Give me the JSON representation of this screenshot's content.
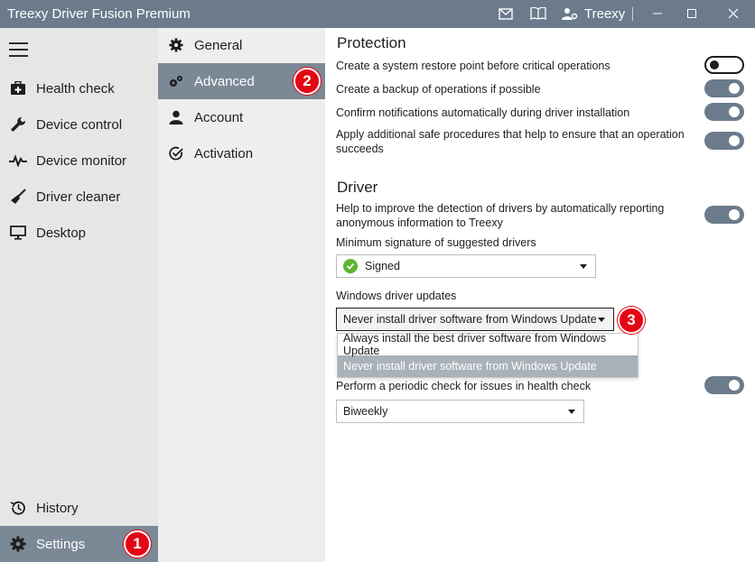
{
  "window": {
    "title": "Treexy Driver Fusion Premium",
    "user_label": "Treexy"
  },
  "leftnav": {
    "items": [
      {
        "label": "Health check"
      },
      {
        "label": "Device control"
      },
      {
        "label": "Device monitor"
      },
      {
        "label": "Driver cleaner"
      },
      {
        "label": "Desktop"
      }
    ],
    "bottom": [
      {
        "label": "History"
      },
      {
        "label": "Settings"
      }
    ]
  },
  "subnav": {
    "items": [
      {
        "label": "General"
      },
      {
        "label": "Advanced"
      },
      {
        "label": "Account"
      },
      {
        "label": "Activation"
      }
    ]
  },
  "badges": [
    "1",
    "2",
    "3"
  ],
  "protection": {
    "title": "Protection",
    "options": [
      {
        "text": "Create a system restore point before critical operations",
        "enabled": false
      },
      {
        "text": "Create a backup of operations if possible",
        "enabled": true
      },
      {
        "text": "Confirm notifications automatically during driver installation",
        "enabled": true
      },
      {
        "text": "Apply additional safe procedures that help to ensure that an operation succeeds",
        "enabled": true
      }
    ]
  },
  "driver": {
    "title": "Driver",
    "report_option": {
      "text": "Help to improve the detection of drivers by automatically reporting anonymous information to Treexy",
      "enabled": true
    },
    "signature_label": "Minimum signature of suggested drivers",
    "signature_value": "Signed",
    "updates_label": "Windows driver updates",
    "updates_value": "Never install driver software from Windows Update",
    "updates_options": [
      "Always install the best driver software from Windows Update",
      "Never install driver software from Windows Update"
    ],
    "periodic_option": {
      "text": "Perform a periodic check for issues in health check",
      "enabled": true
    },
    "periodic_value": "Biweekly"
  },
  "colors": {
    "titlebar": "#6b7b8c",
    "active_item": "#7b8896",
    "badge": "#e30613",
    "toggle_on": "#6b7b8c"
  }
}
